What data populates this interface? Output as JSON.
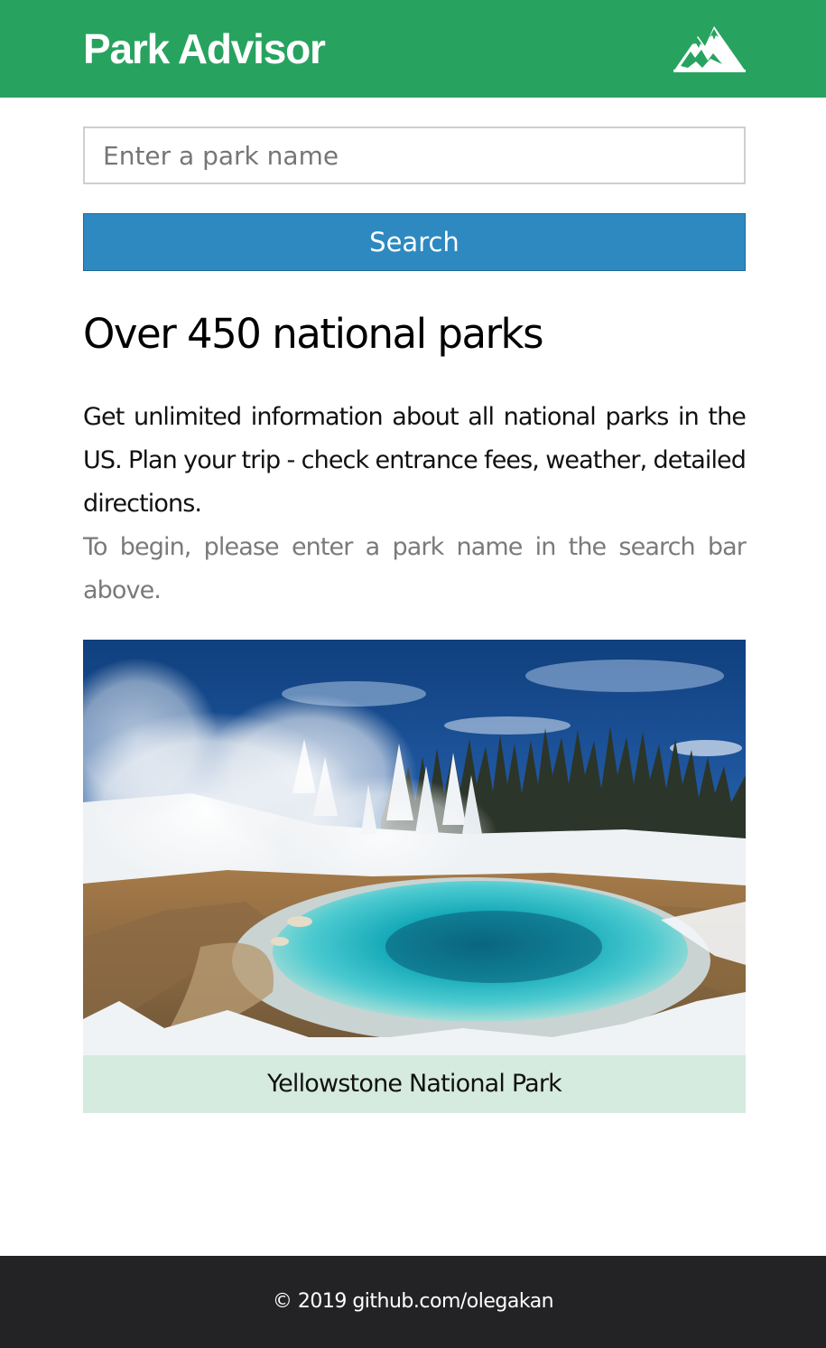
{
  "header": {
    "brand": "Park Advisor",
    "logo_icon": "mountain-icon",
    "background_color": "#27a35f"
  },
  "search": {
    "placeholder": "Enter a park name",
    "value": "",
    "button_label": "Search",
    "button_color": "#2e89c0"
  },
  "intro": {
    "heading": "Over 450 national parks",
    "description": "Get unlimited information about all national parks in the US. Plan your trip - check entrance fees, weather, detailed directions.",
    "hint": "To begin, please enter a park name in the search bar above."
  },
  "featured": {
    "caption": "Yellowstone National Park",
    "caption_background": "#d6ebe0"
  },
  "footer": {
    "text": "© 2019 github.com/olegakan",
    "background_color": "#232325"
  }
}
